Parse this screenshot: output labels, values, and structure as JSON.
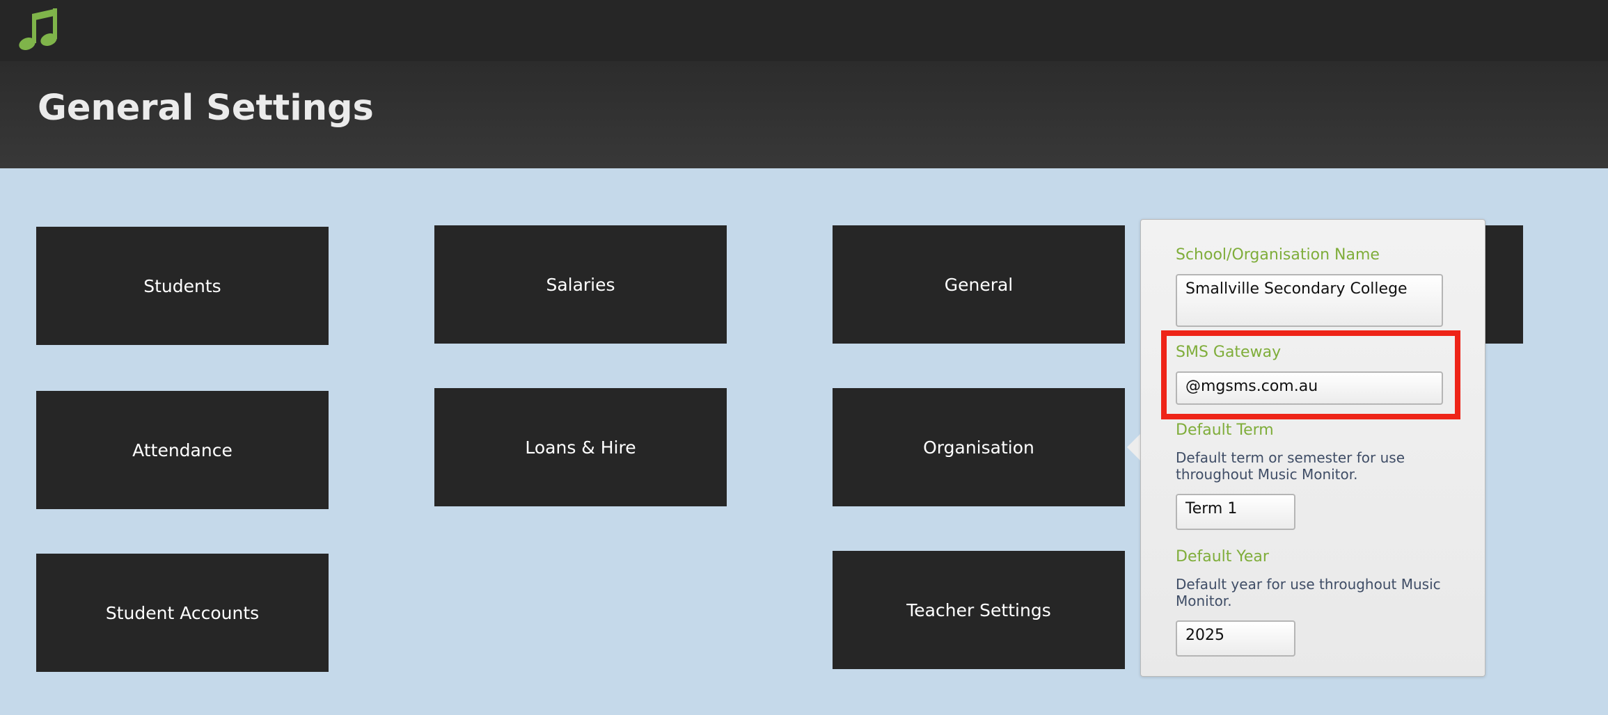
{
  "header": {
    "logo_icon": "music-note-icon",
    "logo_color": "#7fb44a",
    "title": "General Settings"
  },
  "tiles": {
    "students": "Students",
    "salaries": "Salaries",
    "general": "General",
    "attendance": "Attendance",
    "loans_hire": "Loans & Hire",
    "organisation": "Organisation",
    "student_accounts": "Student Accounts",
    "teacher_settings": "Teacher Settings"
  },
  "popover": {
    "school_name": {
      "label": "School/Organisation Name",
      "value": "Smallville Secondary College"
    },
    "sms_gateway": {
      "label": "SMS Gateway",
      "value": "@mgsms.com.au"
    },
    "default_term": {
      "label": "Default Term",
      "description": "Default term or semester for use throughout Music Monitor.",
      "value": "Term 1"
    },
    "default_year": {
      "label": "Default Year",
      "description": "Default year for use throughout Music Monitor.",
      "value": "2025"
    }
  },
  "colors": {
    "accent_green": "#7fad3a",
    "tile_background": "#262626",
    "page_background": "#c5d9ea",
    "highlight_red": "#ee2418"
  }
}
